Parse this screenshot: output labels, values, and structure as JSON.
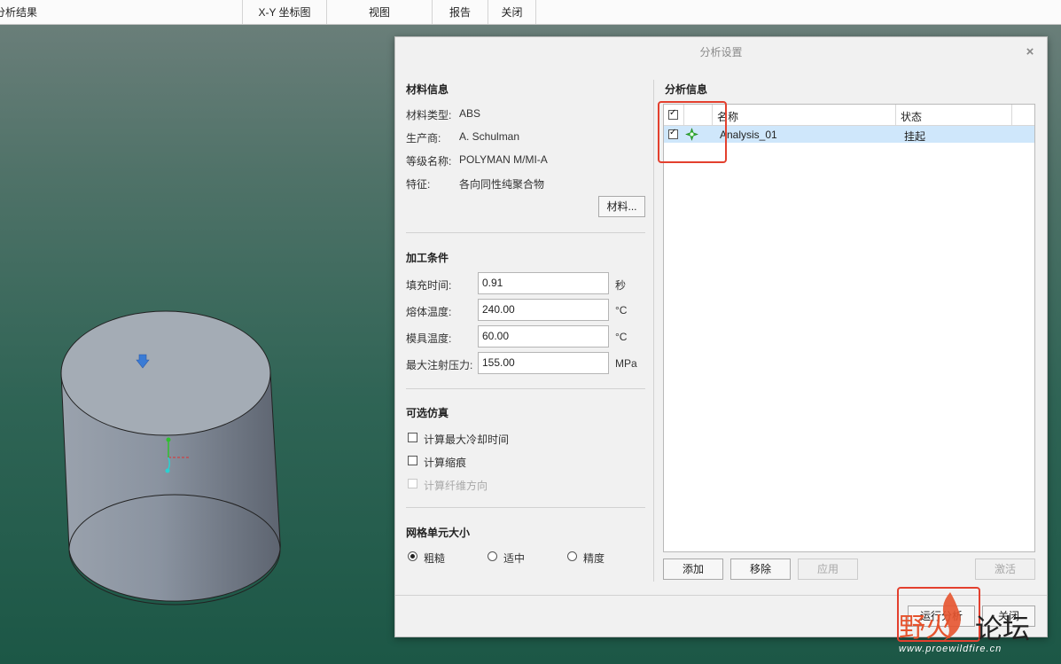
{
  "menubar": {
    "items": [
      "分析结果",
      "X-Y 坐标图",
      "视图",
      "报告",
      "关闭"
    ]
  },
  "dialog": {
    "title": "分析设置",
    "close_glyph": "×",
    "material": {
      "section_title": "材料信息",
      "rows": [
        {
          "label": "材料类型:",
          "value": "ABS"
        },
        {
          "label": "生产商:",
          "value": "A. Schulman"
        },
        {
          "label": "等级名称:",
          "value": "POLYMAN M/MI-A"
        },
        {
          "label": "特征:",
          "value": "各向同性纯聚合物"
        }
      ],
      "button": "材料..."
    },
    "process": {
      "section_title": "加工条件",
      "rows": [
        {
          "label": "填充时间:",
          "value": "0.91",
          "unit": "秒"
        },
        {
          "label": "熔体温度:",
          "value": "240.00",
          "unit": "°C"
        },
        {
          "label": "模具温度:",
          "value": "60.00",
          "unit": "°C"
        },
        {
          "label": "最大注射压力:",
          "value": "155.00",
          "unit": "MPa"
        }
      ]
    },
    "optional": {
      "section_title": "可选仿真",
      "options": [
        {
          "label": "计算最大冷却时间",
          "checked": false,
          "enabled": true
        },
        {
          "label": "计算缩痕",
          "checked": false,
          "enabled": true
        },
        {
          "label": "计算纤维方向",
          "checked": false,
          "enabled": false
        }
      ]
    },
    "mesh": {
      "section_title": "网格单元大小",
      "options": [
        {
          "label": "粗糙",
          "selected": true
        },
        {
          "label": "适中",
          "selected": false
        },
        {
          "label": "精度",
          "selected": false
        }
      ]
    },
    "analysis_info": {
      "section_title": "分析信息",
      "columns": [
        "名称",
        "状态"
      ],
      "rows": [
        {
          "name": "Analysis_01",
          "status": "挂起",
          "checked": true
        }
      ],
      "buttons": {
        "add": "添加",
        "remove": "移除",
        "apply": "应用",
        "activate": "激活"
      }
    },
    "footer": {
      "run": "运行分析",
      "close": "关闭"
    }
  },
  "watermark": {
    "chars": "野火论坛",
    "url": "www.proewildfire.cn"
  },
  "colors": {
    "accent_selection": "#cfe7fb",
    "highlight_box": "#e3402e",
    "analysis_icon": "#2fb52f"
  }
}
